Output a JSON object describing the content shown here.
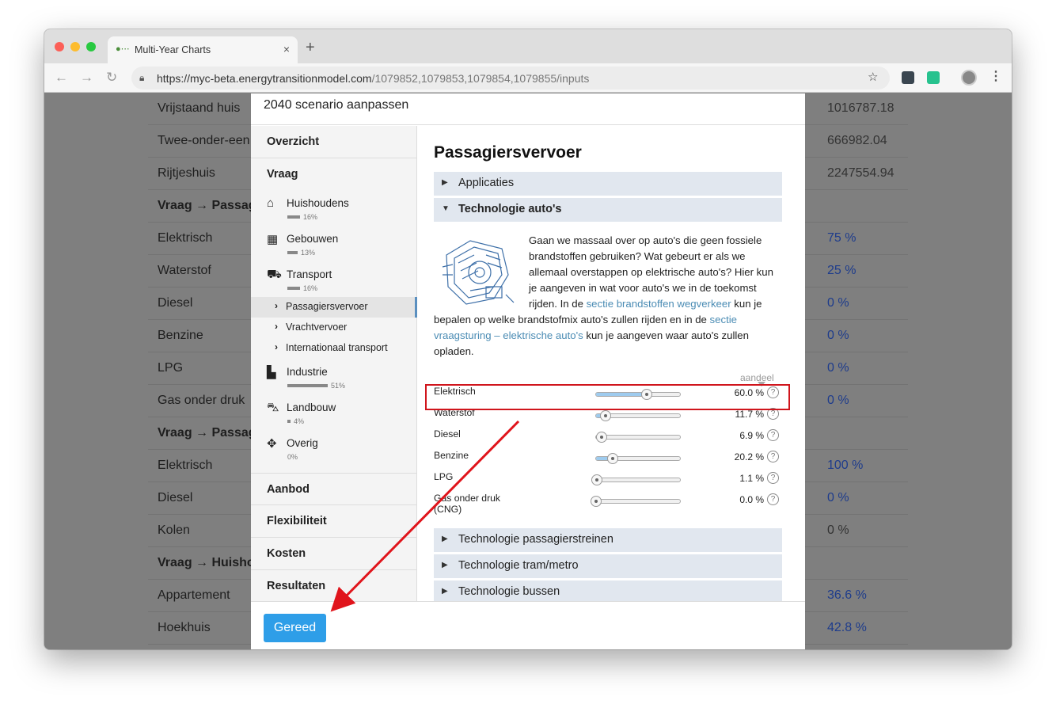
{
  "browser": {
    "tab_title": "Multi-Year Charts",
    "tab_close": "×",
    "new_tab": "+",
    "url_host": "https://myc-beta.energytransitionmodel.com",
    "url_path": "/1079852,1079853,1079854,1079855/inputs"
  },
  "background_rows": [
    {
      "label": "Vrijstaand huis",
      "value": "1016787.18",
      "bold": false,
      "blue": false
    },
    {
      "label": "Twee-onder-een",
      "value": "666982.04",
      "bold": false,
      "blue": false
    },
    {
      "label": "Rijtjeshuis",
      "value": "2247554.94",
      "bold": false,
      "blue": false
    },
    {
      "label": "Vraag → Passag",
      "value": "",
      "bold": true,
      "blue": false
    },
    {
      "label": "Elektrisch",
      "value": "75 %",
      "bold": false,
      "blue": true
    },
    {
      "label": "Waterstof",
      "value": "25 %",
      "bold": false,
      "blue": true
    },
    {
      "label": "Diesel",
      "value": "0 %",
      "bold": false,
      "blue": true
    },
    {
      "label": "Benzine",
      "value": "0 %",
      "bold": false,
      "blue": true
    },
    {
      "label": "LPG",
      "value": "0 %",
      "bold": false,
      "blue": true
    },
    {
      "label": "Gas onder druk",
      "value": "0 %",
      "bold": false,
      "blue": true
    },
    {
      "label": "Vraag → Passag",
      "value": "",
      "bold": true,
      "blue": false
    },
    {
      "label": "Elektrisch",
      "value": "100 %",
      "bold": false,
      "blue": true
    },
    {
      "label": "Diesel",
      "value": "0 %",
      "bold": false,
      "blue": true
    },
    {
      "label": "Kolen",
      "value": "0 %",
      "bold": false,
      "blue": false
    },
    {
      "label": "Vraag → Huisho",
      "value": "",
      "bold": true,
      "blue": false
    },
    {
      "label": "Appartement",
      "value": "36.6 %",
      "bold": false,
      "blue": true
    },
    {
      "label": "Hoekhuis",
      "value": "42.8 %",
      "bold": false,
      "blue": true
    }
  ],
  "modal": {
    "title": "2040 scenario aanpassen",
    "done_button": "Gereed"
  },
  "sidebar": {
    "overzicht": "Overzicht",
    "vraag": "Vraag",
    "items": [
      {
        "label": "Huishoudens",
        "pct": "16%",
        "share": 16
      },
      {
        "label": "Gebouwen",
        "pct": "13%",
        "share": 13
      },
      {
        "label": "Transport",
        "pct": "16%",
        "share": 16
      },
      {
        "label": "Industrie",
        "pct": "51%",
        "share": 51
      },
      {
        "label": "Landbouw",
        "pct": "4%",
        "share": 4
      },
      {
        "label": "Overig",
        "pct": "0%",
        "share": 0
      }
    ],
    "sub_items": [
      "Passagiersvervoer",
      "Vrachtvervoer",
      "Internationaal transport"
    ],
    "aanbod": "Aanbod",
    "flexibiliteit": "Flexibiliteit",
    "kosten": "Kosten",
    "resultaten": "Resultaten"
  },
  "main": {
    "heading": "Passagiersvervoer",
    "accordion_applicaties": "Applicaties",
    "accordion_technologie_autos": "Technologie auto's",
    "description_1": "Gaan we massaal over op auto's die geen fossiele brandstoffen gebruiken? Wat gebeurt er als we allemaal overstappen op elektrische auto's? Hier kun je aangeven in wat voor auto's we in de toekomst rijden. In de ",
    "link_1": "sectie brandstoffen wegverkeer",
    "description_2": " kun je bepalen op welke brandstofmix auto's zullen rijden en in de ",
    "link_2": "sectie vraagsturing – elektrische auto's",
    "description_3": " kun je aangeven waar auto's zullen opladen.",
    "column_header": "aandeel",
    "sliders": [
      {
        "label": "Elektrisch",
        "value_text": "60.0 %",
        "value": 60.0
      },
      {
        "label": "Waterstof",
        "value_text": "11.7 %",
        "value": 11.7
      },
      {
        "label": "Diesel",
        "value_text": "6.9 %",
        "value": 6.9
      },
      {
        "label": "Benzine",
        "value_text": "20.2 %",
        "value": 20.2
      },
      {
        "label": "LPG",
        "value_text": "1.1 %",
        "value": 1.1
      },
      {
        "label": "Gas onder druk (CNG)",
        "value_text": "0.0 %",
        "value": 0.0
      }
    ],
    "accordion_passagierstreinen": "Technologie passagierstreinen",
    "accordion_tram": "Technologie tram/metro",
    "accordion_bussen": "Technologie bussen"
  },
  "colors": {
    "accent": "#2e9ee8",
    "highlight": "#d0151c",
    "link": "#4b8cb4"
  }
}
